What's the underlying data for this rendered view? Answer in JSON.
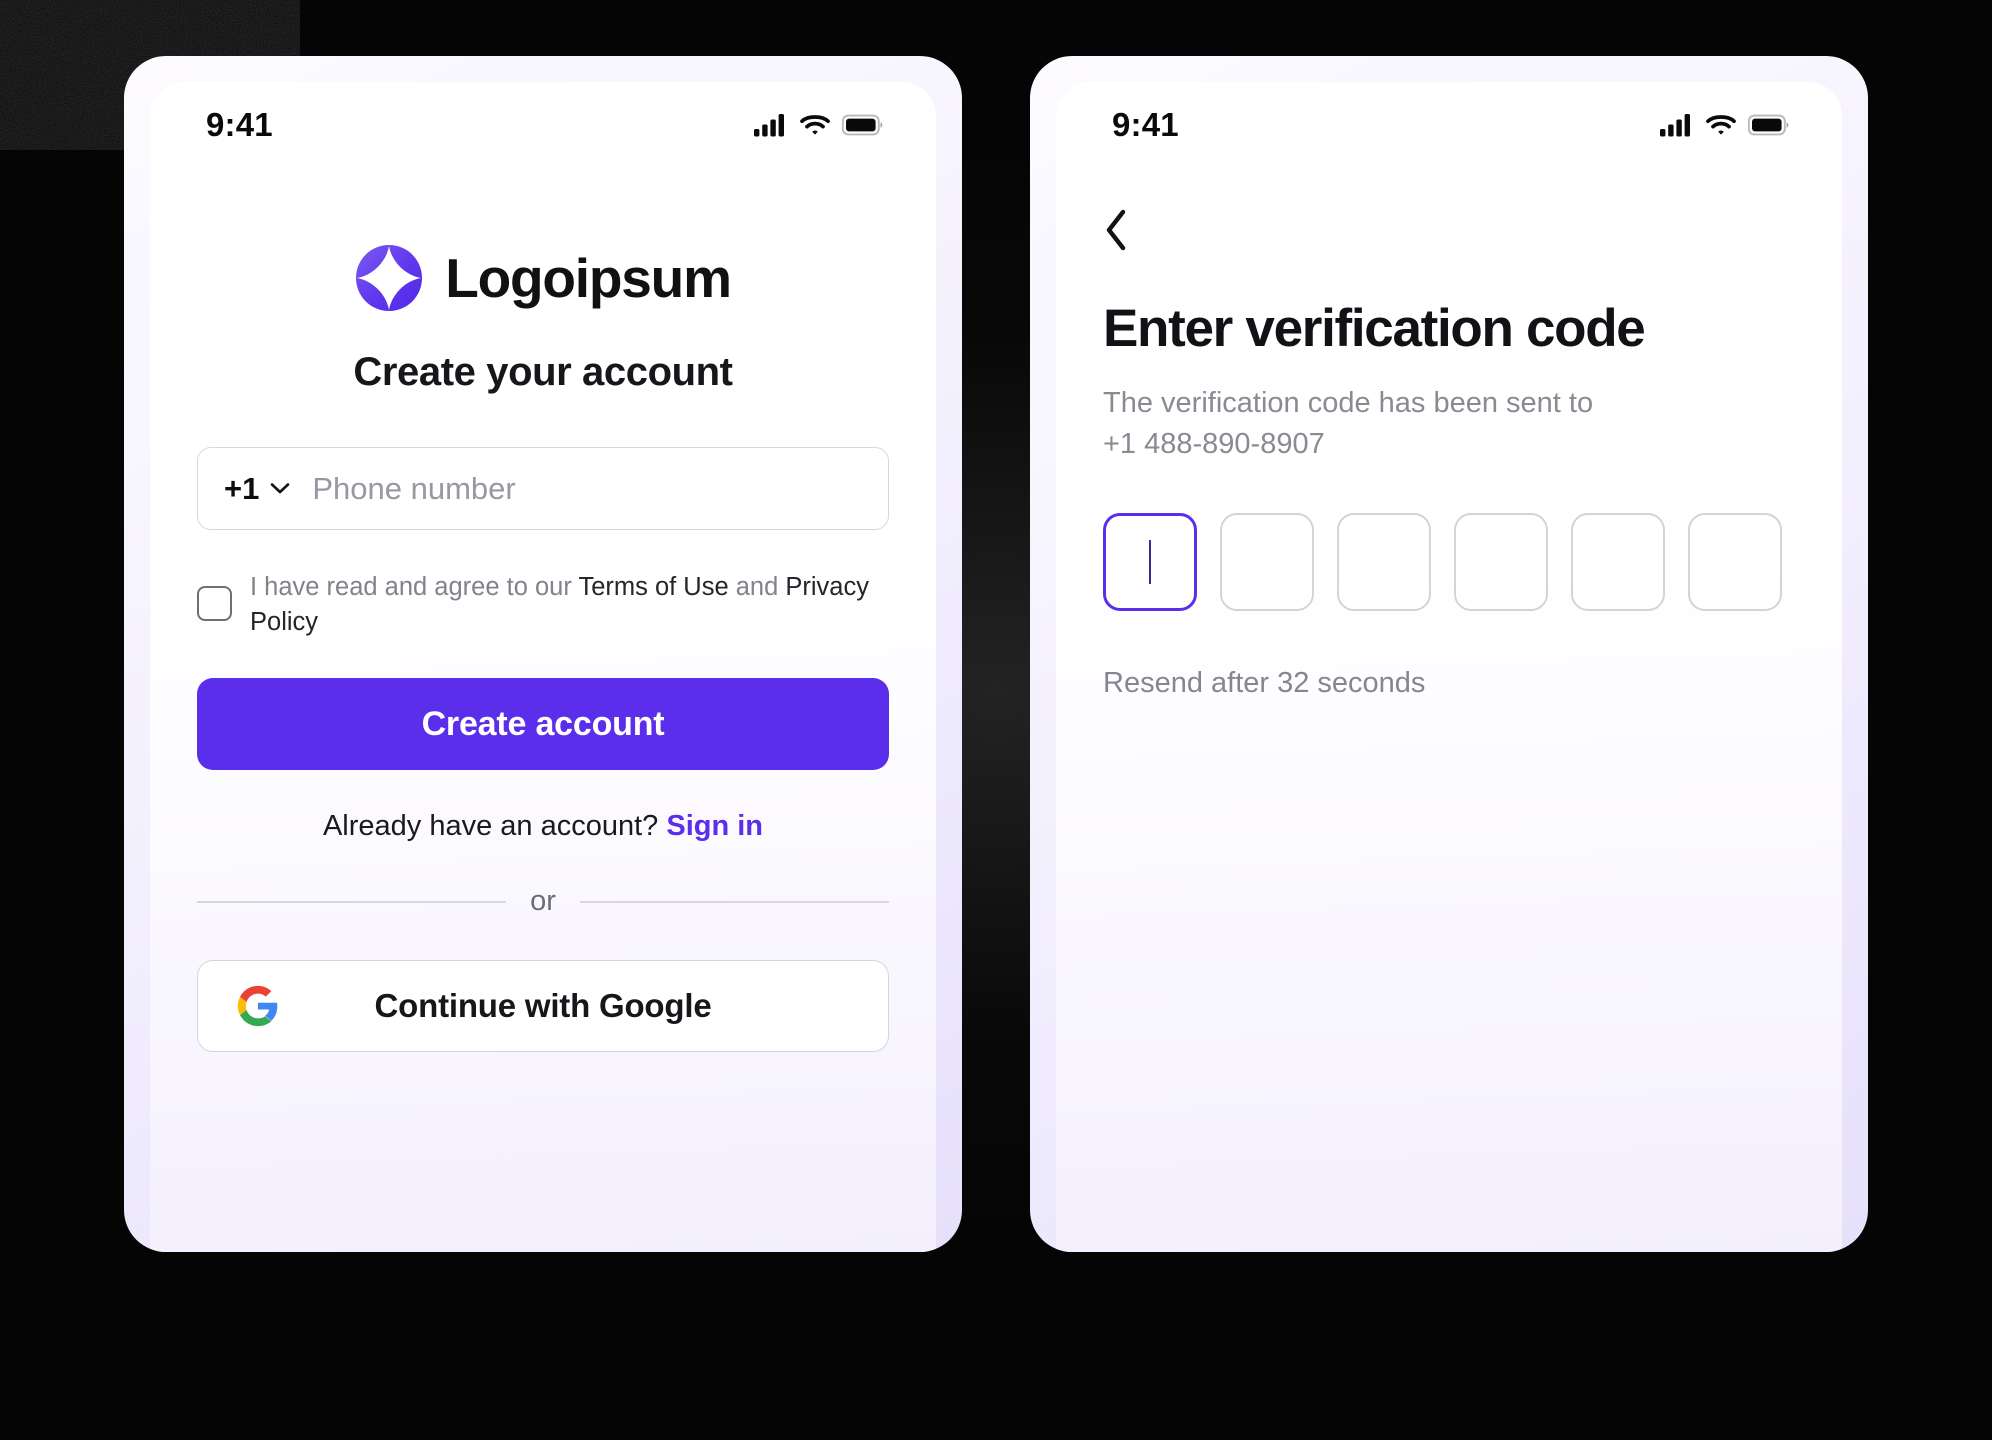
{
  "theme": {
    "accent_purple": "#5B2EEB",
    "backdrop": "#000000",
    "card_lavender": "#E6E0FB",
    "screen_white": "#FFFFFF",
    "muted_text": "#8B8992",
    "border_gray": "#D5D2DB"
  },
  "screens": [
    {
      "id": "signup",
      "status_bar": {
        "time": "9:41",
        "icons": [
          "cellular-signal-icon",
          "wifi-icon",
          "battery-icon"
        ]
      },
      "brand": {
        "logo_icon": "logoipsum-star-icon",
        "name": "Logoipsum"
      },
      "heading": "Create your account",
      "phone_field": {
        "country_code": "+1",
        "chevron_icon": "chevron-down-icon",
        "placeholder": "Phone number",
        "value": ""
      },
      "terms": {
        "checked": false,
        "prefix": "I have read and agree to our ",
        "link_terms": "Terms of Use",
        "conjunction": " and ",
        "link_privacy": "Privacy Policy"
      },
      "primary_button": "Create account",
      "signin": {
        "prompt": "Already have an account?",
        "link": "Sign in"
      },
      "divider_label": "or",
      "google_button": {
        "icon": "google-g-icon",
        "label": "Continue with Google"
      }
    },
    {
      "id": "verification",
      "status_bar": {
        "time": "9:41",
        "icons": [
          "cellular-signal-icon",
          "wifi-icon",
          "battery-icon"
        ]
      },
      "back_icon": "chevron-left-icon",
      "title": "Enter verification code",
      "subtitle_line1": "The verification code has been sent to",
      "subtitle_line2": "+1 488-890-8907",
      "otp": {
        "length": 6,
        "active_index": 0,
        "values": [
          "",
          "",
          "",
          "",
          "",
          ""
        ]
      },
      "resend": "Resend after 32 seconds"
    }
  ]
}
